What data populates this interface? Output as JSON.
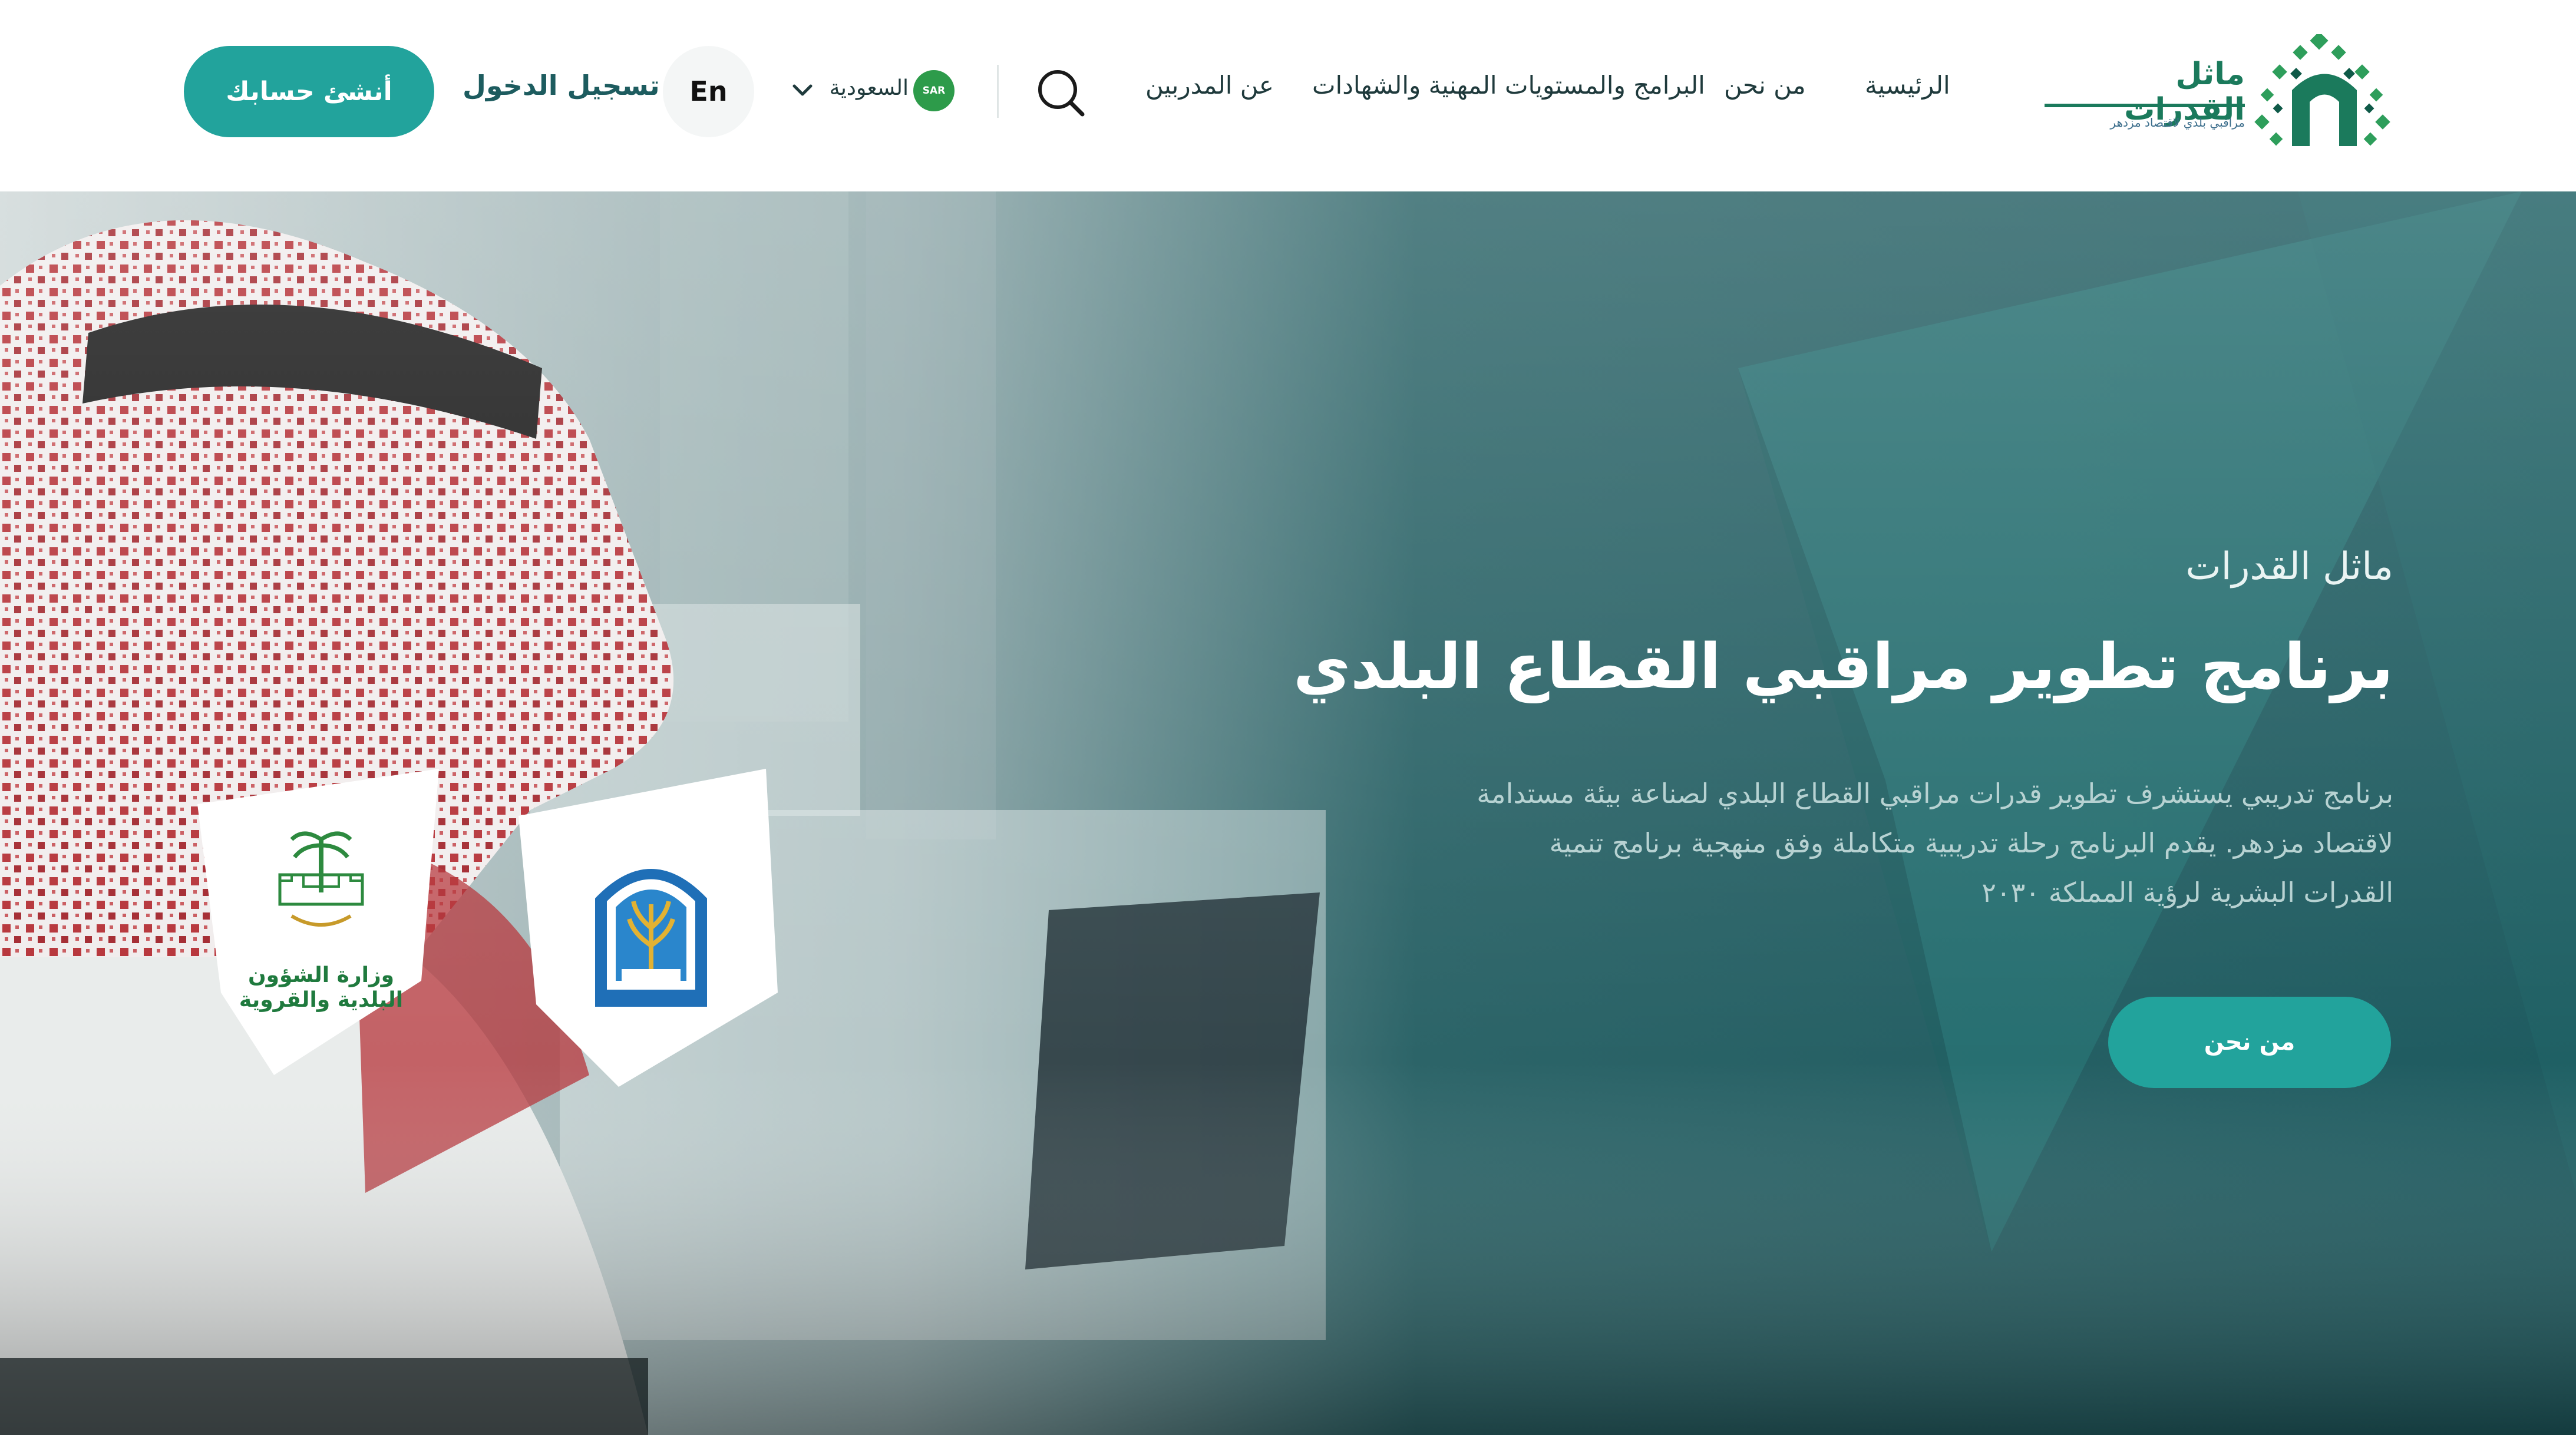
{
  "brand": {
    "name": "ماثل القدرات",
    "tagline": "مراقبي بلدي لاقتصاد مزدهر"
  },
  "nav": {
    "items": [
      {
        "label": "الرئيسية"
      },
      {
        "label": "من نحن"
      },
      {
        "label": "البرامج والمستويات المهنية والشهادات"
      },
      {
        "label": "عن المدربين"
      }
    ],
    "search_icon": "search-icon",
    "country": {
      "label": "السعودية",
      "flag_text": "SAR"
    },
    "language_button": "En",
    "login_label": "تسجيل الدخول",
    "signup_label": "أنشئ حسابك"
  },
  "hero": {
    "eyebrow": "ماثل القدرات",
    "title": "برنامج تطوير مراقبي القطاع البلدي",
    "description": "برنامج تدريبي يستشرف تطوير قدرات مراقبي القطاع البلدي لصناعة بيئة مستدامة لاقتصاد مزدهر.  يقدم البرنامج رحلة تدريبية متكاملة وفق منهجية برنامج تنمية القدرات البشرية لرؤية المملكة ٢٠٣٠",
    "cta_label": "من نحن",
    "partners": [
      {
        "caption": "وزارة الشؤون البلدية والقروية",
        "icon": "ministry-logo-icon"
      },
      {
        "caption": "",
        "icon": "university-logo-icon"
      }
    ]
  },
  "colors": {
    "accent": "#22a39c",
    "hero_bg": "#1e5b60",
    "brand_green": "#1b7a5c"
  }
}
